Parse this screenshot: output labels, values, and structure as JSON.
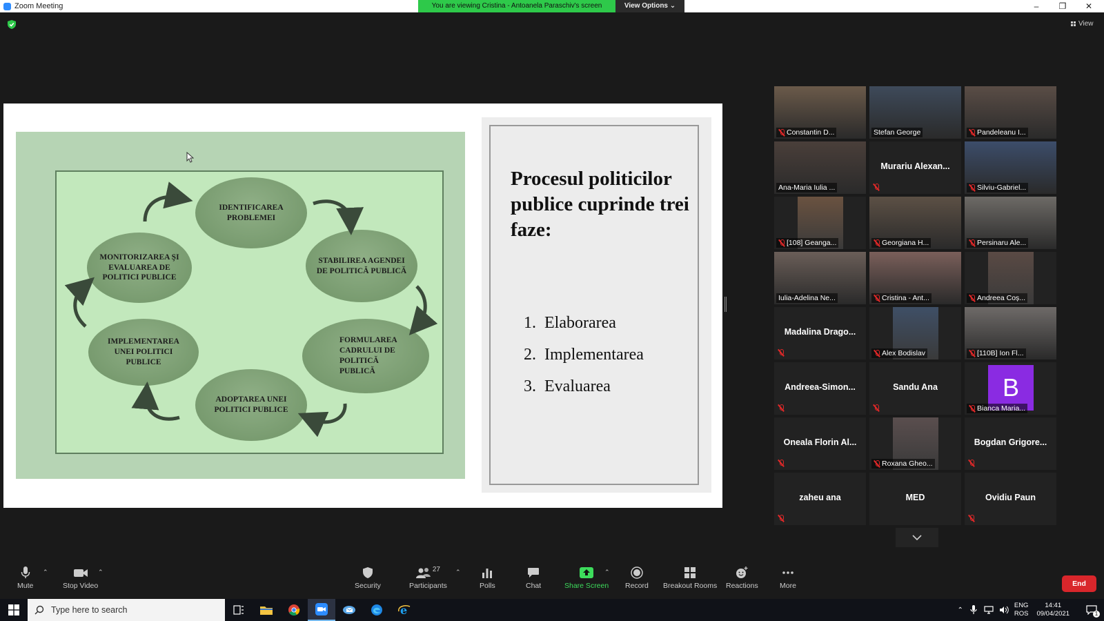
{
  "window": {
    "title": "Zoom Meeting",
    "viewing_banner": "You are viewing Cristina - Antoanela Paraschiv's screen",
    "view_options": "View Options ⌄",
    "view_button": "View"
  },
  "slide": {
    "title": "Procesul politicilor publice cuprinde trei faze:",
    "phases": [
      {
        "num": "1.",
        "text": "Elaborarea"
      },
      {
        "num": "2.",
        "text": "Implementarea"
      },
      {
        "num": "3.",
        "text": "Evaluarea"
      }
    ],
    "cycle": {
      "identificarea": "IDENTIFICAREA PROBLEMEI",
      "stabilirea": "STABILIREA AGENDEI DE POLITICĂ PUBLICĂ",
      "formularea": "FORMULAREA CADRULUI DE POLITICĂ PUBLICĂ",
      "adoptarea": "ADOPTAREA UNEI POLITICI PUBLICE",
      "implementarea": "IMPLEMENTAREA UNEI POLITICI PUBLICE",
      "monitorizarea": "MONITORIZAREA ŞI EVALUAREA DE POLITICI PUBLICE"
    }
  },
  "participants": [
    {
      "name": "Constantin D...",
      "video": true,
      "muted": true
    },
    {
      "name": "Stefan George",
      "video": true,
      "muted": false
    },
    {
      "name": "Pandeleanu I...",
      "video": true,
      "muted": true
    },
    {
      "name": "Ana-Maria Iulia ...",
      "video": true,
      "muted": false
    },
    {
      "name": "Murariu Alexan...",
      "video": false,
      "muted": true
    },
    {
      "name": "Silviu-Gabriel...",
      "video": true,
      "muted": true
    },
    {
      "name": "[108] Geanga...",
      "video": true,
      "muted": true
    },
    {
      "name": "Georgiana H...",
      "video": true,
      "muted": true
    },
    {
      "name": "Persinaru Ale...",
      "video": true,
      "muted": true
    },
    {
      "name": "Iulia-Adelina Ne...",
      "video": true,
      "muted": false,
      "active": true
    },
    {
      "name": "Cristina - Ant...",
      "video": true,
      "muted": true
    },
    {
      "name": "Andreea Coș...",
      "video": true,
      "muted": true
    },
    {
      "name": "Madalina Drago...",
      "video": false,
      "muted": true
    },
    {
      "name": "Alex Bodislav",
      "video": true,
      "muted": true
    },
    {
      "name": "[110B] Ion Fl...",
      "video": true,
      "muted": true
    },
    {
      "name": "Andreea-Simon...",
      "video": false,
      "muted": true
    },
    {
      "name": "Sandu Ana",
      "video": false,
      "muted": true
    },
    {
      "name": "Bianca Maria...",
      "video": false,
      "muted": true,
      "avatar_letter": "B"
    },
    {
      "name": "Oneala Florin Al...",
      "video": false,
      "muted": true
    },
    {
      "name": "Roxana Gheo...",
      "video": true,
      "muted": true
    },
    {
      "name": "Bogdan Grigore...",
      "video": false,
      "muted": true
    },
    {
      "name": "zaheu ana",
      "video": false,
      "muted": true
    },
    {
      "name": "MED",
      "video": false,
      "muted": false
    },
    {
      "name": "Ovidiu Paun",
      "video": false,
      "muted": true
    }
  ],
  "toolbar": {
    "mute": "Mute",
    "stop_video": "Stop Video",
    "security": "Security",
    "participants": "Participants",
    "participant_count": "27",
    "polls": "Polls",
    "chat": "Chat",
    "share_screen": "Share Screen",
    "record": "Record",
    "breakout_rooms": "Breakout Rooms",
    "reactions": "Reactions",
    "more": "More",
    "end": "End"
  },
  "taskbar": {
    "search_placeholder": "Type here to search",
    "lang_top": "ENG",
    "lang_bottom": "ROS",
    "time": "14:41",
    "date": "09/04/2021",
    "notification_count": "1"
  },
  "colors": {
    "banner_green": "#2ec94a",
    "share_green": "#3ddc5c",
    "end_red": "#d9262b",
    "active_speaker": "#f0e84a",
    "bianca_avatar": "#8a2be2"
  }
}
